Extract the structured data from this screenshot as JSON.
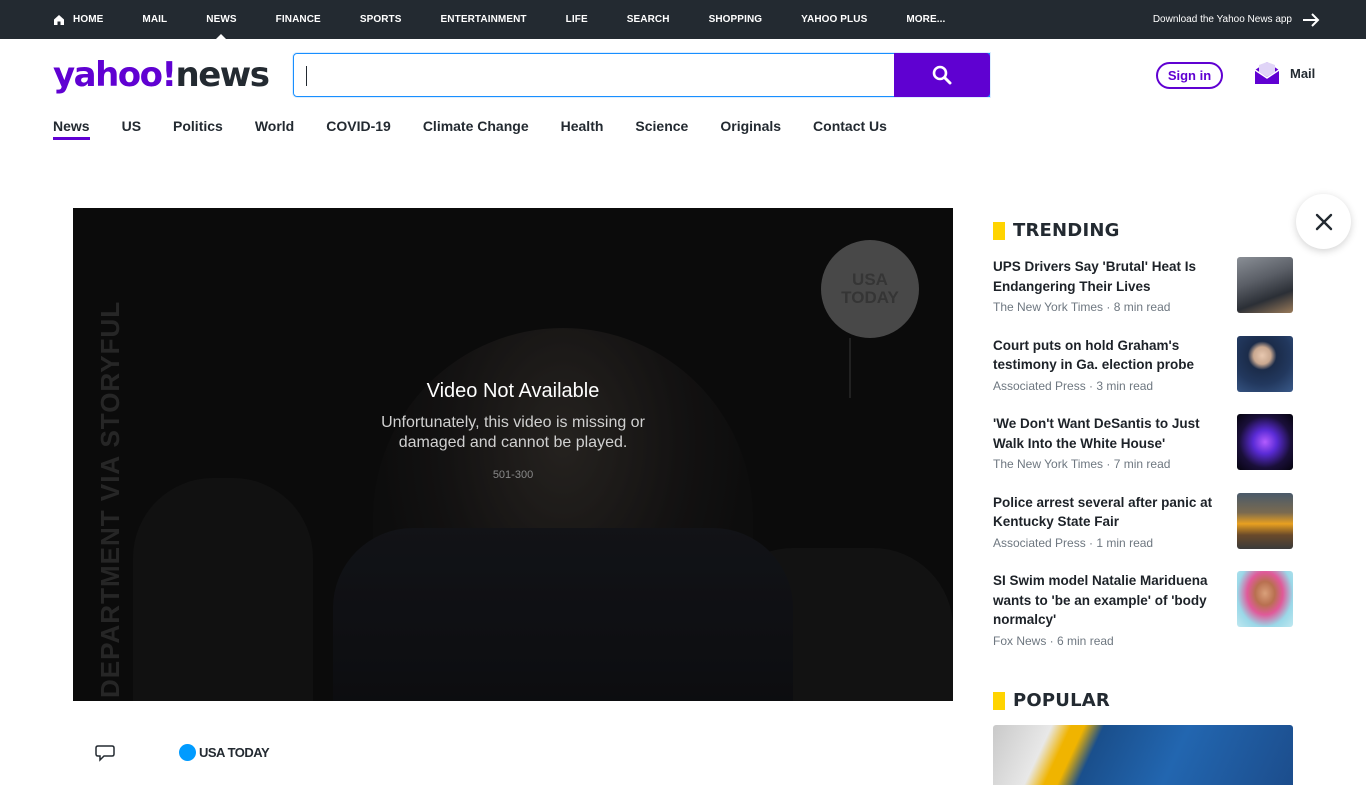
{
  "topnav": {
    "items": [
      "HOME",
      "MAIL",
      "NEWS",
      "FINANCE",
      "SPORTS",
      "ENTERTAINMENT",
      "LIFE",
      "SEARCH",
      "SHOPPING",
      "YAHOO PLUS",
      "MORE..."
    ],
    "active_index": 2,
    "download_app": "Download the Yahoo News app"
  },
  "header": {
    "logo_brand": "yahoo!",
    "logo_section": "news",
    "search_value": "",
    "signin_label": "Sign in",
    "mail_label": "Mail"
  },
  "subnav": {
    "items": [
      "News",
      "US",
      "Politics",
      "World",
      "COVID-19",
      "Climate Change",
      "Health",
      "Science",
      "Originals",
      "Contact Us"
    ],
    "active_index": 0
  },
  "video": {
    "title": "Video Not Available",
    "message": "Unfortunately, this video is missing or damaged and cannot be played.",
    "error_code": "501-300",
    "badge_line1": "USA",
    "badge_line2": "TODAY",
    "watermark": "DEPARTMENT VIA STORYFUL"
  },
  "article": {
    "source_label": "USA TODAY"
  },
  "trending": {
    "title": "TRENDING",
    "items": [
      {
        "title": "UPS Drivers Say 'Brutal' Heat Is Endangering Their Lives",
        "source": "The New York Times",
        "time": "8 min read"
      },
      {
        "title": "Court puts on hold Graham's testimony in Ga. election probe",
        "source": "Associated Press",
        "time": "3 min read"
      },
      {
        "title": "'We Don't Want DeSantis to Just Walk Into the White House'",
        "source": "The New York Times",
        "time": "7 min read"
      },
      {
        "title": "Police arrest several after panic at Kentucky State Fair",
        "source": "Associated Press",
        "time": "1 min read"
      },
      {
        "title": "SI Swim model Natalie Mariduena wants to 'be an example' of 'body normalcy'",
        "source": "Fox News",
        "time": "6 min read"
      }
    ]
  },
  "popular": {
    "title": "POPULAR"
  },
  "colors": {
    "brand_purple": "#6001d2",
    "topbar_bg": "#232a31",
    "search_border": "#188fff",
    "accent_yellow": "#ffd400"
  }
}
